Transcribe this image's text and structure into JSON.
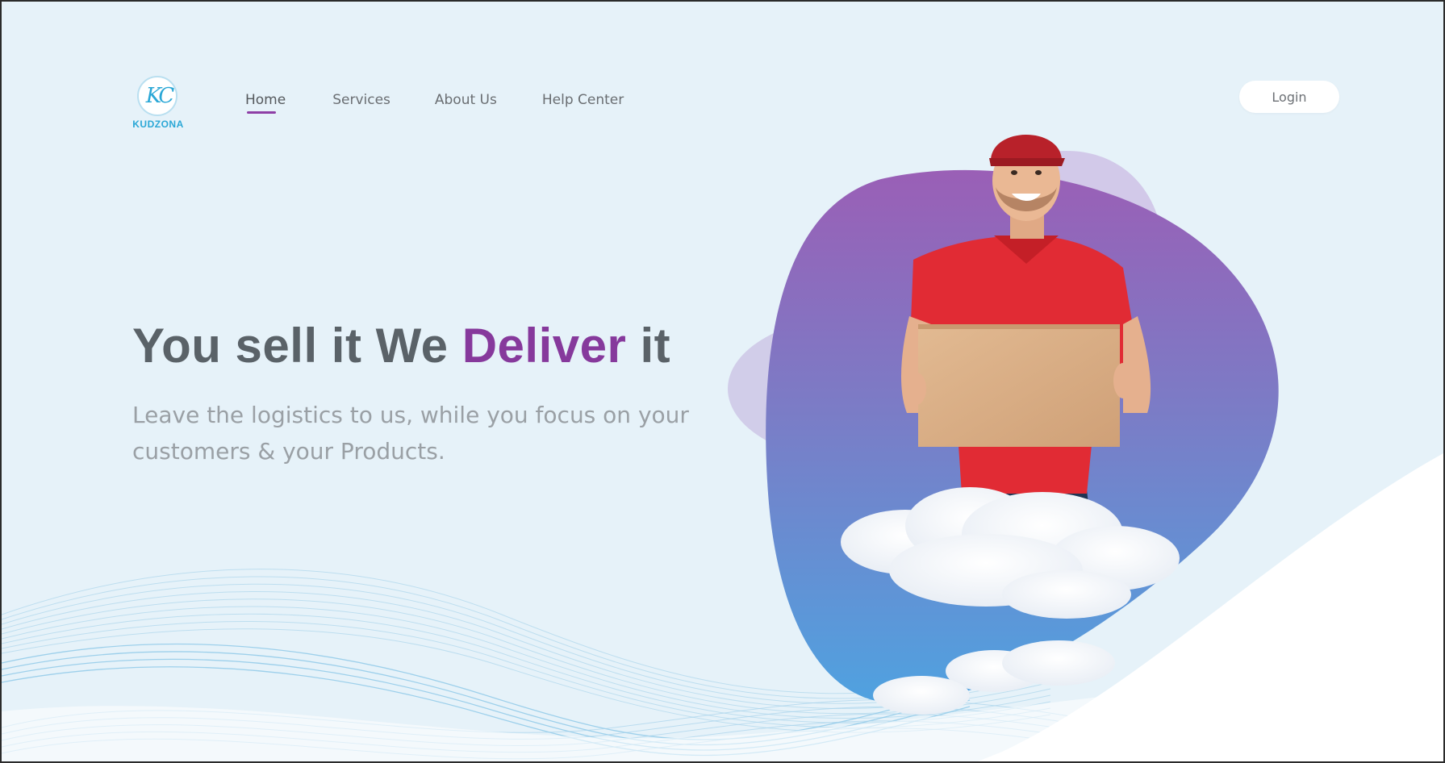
{
  "brand": {
    "logo_mark": "KC",
    "logo_word": "KUDZONA"
  },
  "nav": {
    "items": [
      {
        "label": "Home",
        "active": true
      },
      {
        "label": "Services",
        "active": false
      },
      {
        "label": "About Us",
        "active": false
      },
      {
        "label": "Help Center",
        "active": false
      }
    ]
  },
  "header": {
    "login_label": "Login"
  },
  "hero": {
    "headline_part1": "You sell it We ",
    "headline_accent": "Deliver",
    "headline_part2": " it",
    "subheading": "Leave the logistics to us, while you focus on your customers & your Products."
  },
  "colors": {
    "background": "#e6f2f9",
    "accent": "#86399c",
    "brand": "#2aa7d6",
    "headline": "#5a6268",
    "subtext": "#9aa0a5",
    "blob_top": "#9a5fb6",
    "blob_bottom": "#4fa2e0",
    "shirt": "#e12b34",
    "cap": "#b8212a",
    "box": "#d9ae83"
  },
  "icons": {
    "hero_image": "delivery-man-with-box-on-cloud"
  }
}
